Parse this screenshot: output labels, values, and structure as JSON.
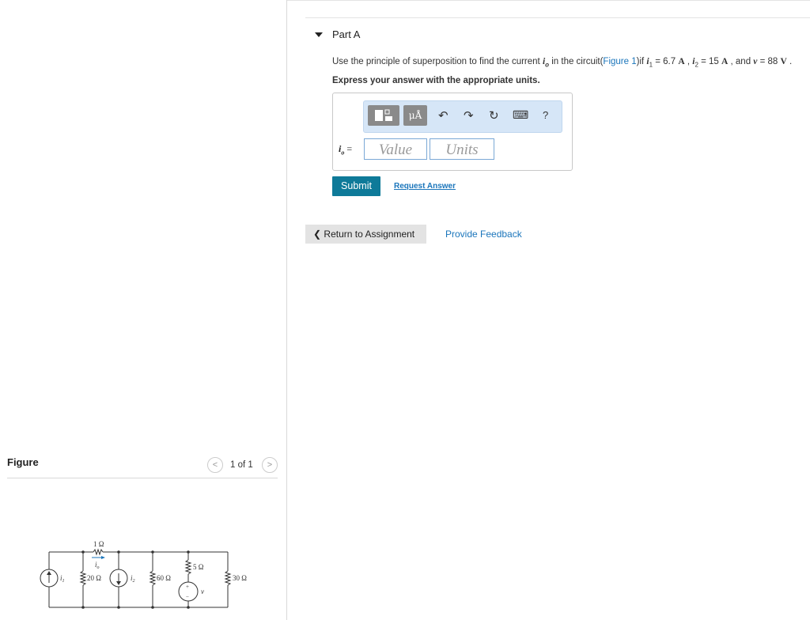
{
  "part": {
    "title": "Part A"
  },
  "question": {
    "prefix": "Use the principle of superposition to find the current ",
    "var_io": "i",
    "sub_o": "o",
    "mid1": " in the circuit(",
    "figure_link": "Figure 1",
    "mid2": ")if ",
    "var_i1": "i",
    "sub_1": "1",
    "eq1": " = 6.7 ",
    "unit_A1": "A",
    "sep1": " , ",
    "var_i2": "i",
    "sub_2": "2",
    "eq2": " = 15 ",
    "unit_A2": "A",
    "sep2": " , and ",
    "var_v": "v",
    "eq3": " = 88 ",
    "unit_V": "V",
    "end": " ."
  },
  "express": "Express your answer with the appropriate units.",
  "toolbar": {
    "units_button": "μÅ",
    "undo_icon": "↶",
    "redo_icon": "↷",
    "reset_icon": "↻",
    "keyboard_icon": "⌨",
    "help": "?"
  },
  "answer": {
    "label_var": "i",
    "label_sub": "o",
    "label_eq": " =",
    "value_placeholder": "Value",
    "units_placeholder": "Units"
  },
  "actions": {
    "submit": "Submit",
    "request_answer": "Request Answer",
    "return": "Return to Assignment",
    "return_icon": "❮",
    "feedback": "Provide Feedback"
  },
  "figure": {
    "title": "Figure",
    "pager": "1 of 1",
    "prev_icon": "<",
    "next_icon": ">",
    "labels": {
      "r1": "1 Ω",
      "io": "i",
      "io_sub": "o",
      "i1": "i",
      "i1_sub": "1",
      "r20": "20 Ω",
      "i2": "i",
      "i2_sub": "2",
      "r60": "60 Ω",
      "r5": "5 Ω",
      "v": "v",
      "plus": "+",
      "minus": "−",
      "r30": "30 Ω"
    }
  },
  "colors": {
    "accent": "#0e7a99",
    "link": "#1a75bb",
    "toolbar_bg": "#d6e6f7"
  }
}
